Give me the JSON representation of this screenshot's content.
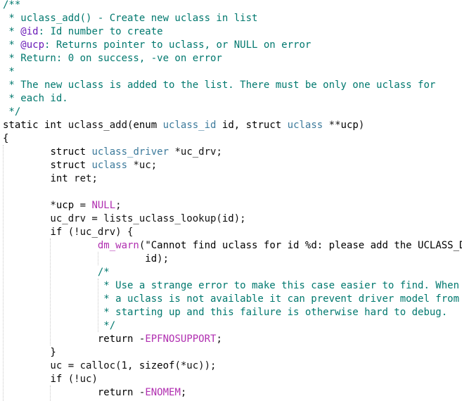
{
  "editor": {
    "language": "C",
    "font": "monospace",
    "colors": {
      "comment": "#00786e",
      "keyword": "#1c1cc4",
      "type": "#3c7a9b",
      "identifier": "#7a3f6e",
      "string": "#b01a1a",
      "macro": "#b02eb0",
      "text": "#111111"
    },
    "lines": [
      [
        {
          "t": "/**",
          "c": "comment"
        }
      ],
      [
        {
          "t": " * uclass_add() - Create new uclass in list",
          "c": "comment"
        }
      ],
      [
        {
          "t": " * ",
          "c": "comment"
        },
        {
          "t": "@id",
          "c": "tag"
        },
        {
          "t": ": Id number to create",
          "c": "comment"
        }
      ],
      [
        {
          "t": " * ",
          "c": "comment"
        },
        {
          "t": "@ucp",
          "c": "tag"
        },
        {
          "t": ": Returns pointer to uclass, or NULL on error",
          "c": "comment"
        }
      ],
      [
        {
          "t": " * Return: 0 on success, -ve on error",
          "c": "comment"
        }
      ],
      [
        {
          "t": " *",
          "c": "comment"
        }
      ],
      [
        {
          "t": " * The new uclass is added to the list. There must be only one uclass for",
          "c": "comment"
        }
      ],
      [
        {
          "t": " * each id.",
          "c": "comment"
        }
      ],
      [
        {
          "t": " */",
          "c": "comment"
        }
      ],
      [
        {
          "t": "static int ",
          "c": "keyword"
        },
        {
          "t": "uclass_add",
          "c": "plain"
        },
        {
          "t": "(",
          "c": "plain"
        },
        {
          "t": "enum ",
          "c": "keyword"
        },
        {
          "t": "uclass_id ",
          "c": "type"
        },
        {
          "t": "id",
          "c": "identifier"
        },
        {
          "t": ", ",
          "c": "plain"
        },
        {
          "t": "struct ",
          "c": "keyword"
        },
        {
          "t": "uclass ",
          "c": "type"
        },
        {
          "t": "**",
          "c": "plain"
        },
        {
          "t": "ucp",
          "c": "identifier"
        },
        {
          "t": ")",
          "c": "plain"
        }
      ],
      [
        {
          "t": "{",
          "c": "keyword"
        }
      ],
      [
        {
          "t": "        ",
          "c": "plain"
        },
        {
          "t": "struct ",
          "c": "keyword"
        },
        {
          "t": "uclass_driver ",
          "c": "type"
        },
        {
          "t": "*uc_drv;",
          "c": "plain"
        }
      ],
      [
        {
          "t": "        ",
          "c": "plain"
        },
        {
          "t": "struct ",
          "c": "keyword"
        },
        {
          "t": "uclass ",
          "c": "type"
        },
        {
          "t": "*uc;",
          "c": "plain"
        }
      ],
      [
        {
          "t": "        ",
          "c": "plain"
        },
        {
          "t": "int ",
          "c": "keyword"
        },
        {
          "t": "ret;",
          "c": "plain"
        }
      ],
      [
        {
          "t": "",
          "c": "plain"
        }
      ],
      [
        {
          "t": "        *",
          "c": "plain"
        },
        {
          "t": "ucp",
          "c": "identifier"
        },
        {
          "t": " = ",
          "c": "plain"
        },
        {
          "t": "NULL",
          "c": "macro"
        },
        {
          "t": ";",
          "c": "plain"
        }
      ],
      [
        {
          "t": "        uc_drv = lists_uclass_lookup(",
          "c": "plain"
        },
        {
          "t": "id",
          "c": "identifier"
        },
        {
          "t": ");",
          "c": "plain"
        }
      ],
      [
        {
          "t": "        ",
          "c": "plain"
        },
        {
          "t": "if ",
          "c": "keyword"
        },
        {
          "t": "(!uc_drv) {",
          "c": "plain"
        }
      ],
      [
        {
          "t": "                ",
          "c": "plain"
        },
        {
          "t": "dm_warn",
          "c": "macro"
        },
        {
          "t": "(",
          "c": "plain"
        },
        {
          "t": "\"Cannot find uclass for id %d: please add the UCLASS_D",
          "c": "string"
        }
      ],
      [
        {
          "t": "                        ",
          "c": "plain"
        },
        {
          "t": "id",
          "c": "identifier"
        },
        {
          "t": ");",
          "c": "plain"
        }
      ],
      [
        {
          "t": "                ",
          "c": "plain"
        },
        {
          "t": "/*",
          "c": "comment"
        }
      ],
      [
        {
          "t": "                ",
          "c": "plain"
        },
        {
          "t": " * Use a strange error to make this case easier to find. When",
          "c": "comment"
        }
      ],
      [
        {
          "t": "                ",
          "c": "plain"
        },
        {
          "t": " * a uclass is not available it can prevent driver model from",
          "c": "comment"
        }
      ],
      [
        {
          "t": "                ",
          "c": "plain"
        },
        {
          "t": " * starting up and this failure is otherwise hard to debug.",
          "c": "comment"
        }
      ],
      [
        {
          "t": "                ",
          "c": "plain"
        },
        {
          "t": " */",
          "c": "comment"
        }
      ],
      [
        {
          "t": "                ",
          "c": "plain"
        },
        {
          "t": "return ",
          "c": "keyword"
        },
        {
          "t": "-",
          "c": "plain"
        },
        {
          "t": "EPFNOSUPPORT",
          "c": "macro"
        },
        {
          "t": ";",
          "c": "plain"
        }
      ],
      [
        {
          "t": "        }",
          "c": "keyword"
        }
      ],
      [
        {
          "t": "        uc = calloc(1, ",
          "c": "plain"
        },
        {
          "t": "sizeof",
          "c": "keyword"
        },
        {
          "t": "(*uc));",
          "c": "plain"
        }
      ],
      [
        {
          "t": "        ",
          "c": "plain"
        },
        {
          "t": "if ",
          "c": "keyword"
        },
        {
          "t": "(!uc)",
          "c": "plain"
        }
      ],
      [
        {
          "t": "                ",
          "c": "plain"
        },
        {
          "t": "return ",
          "c": "keyword"
        },
        {
          "t": "-",
          "c": "plain"
        },
        {
          "t": "ENOMEM",
          "c": "macro"
        },
        {
          "t": ";",
          "c": "plain"
        }
      ]
    ]
  }
}
